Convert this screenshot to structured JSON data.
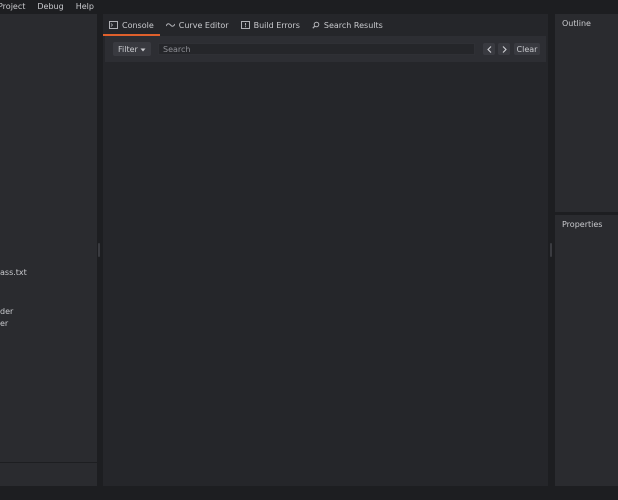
{
  "menubar": {
    "items": [
      "Project",
      "Debug",
      "Help"
    ]
  },
  "left_panel": {
    "items": [
      "ass.txt",
      "der",
      "er"
    ]
  },
  "tabs": [
    {
      "label": "Console",
      "icon": "terminal-icon",
      "active": true
    },
    {
      "label": "Curve Editor",
      "icon": "curve-icon",
      "active": false
    },
    {
      "label": "Build Errors",
      "icon": "build-errors-icon",
      "active": false
    },
    {
      "label": "Search Results",
      "icon": "search-icon",
      "active": false
    }
  ],
  "console": {
    "filter_label": "Filter",
    "search_placeholder": "Search",
    "clear_label": "Clear"
  },
  "right_panel": {
    "outline_title": "Outline",
    "properties_title": "Properties"
  },
  "colors": {
    "accent": "#e0602c",
    "background": "#1d1e21",
    "panel": "#2a2b2f"
  }
}
